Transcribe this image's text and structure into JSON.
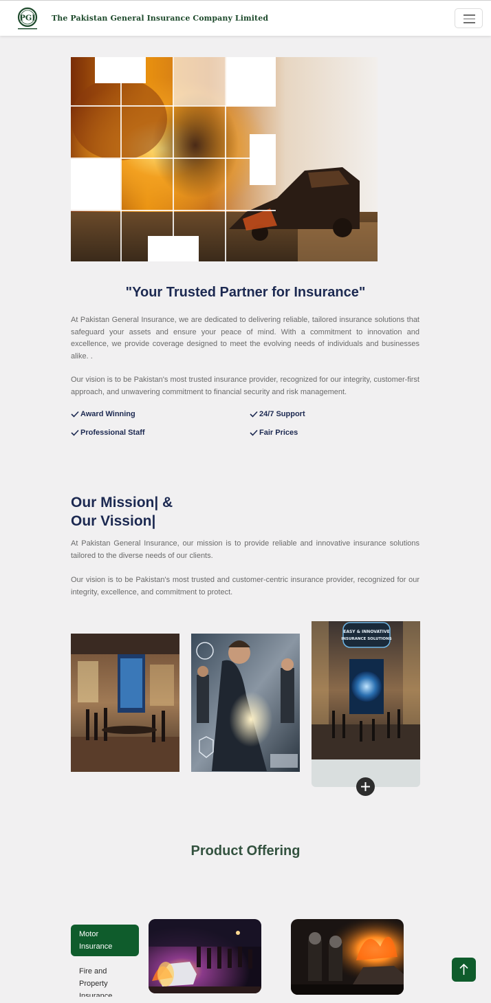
{
  "header": {
    "logo_text": "PGI",
    "company_name": "The Pakistan General Insurance Company Limited",
    "menu_icon": "hamburger-icon"
  },
  "about": {
    "heading": "\"Your Trusted Partner for Insurance\"",
    "paragraph_1": "At Pakistan General Insurance, we are dedicated to delivering reliable, tailored insurance solutions that safeguard your assets and ensure your peace of mind. With a commitment to innovation and excellence, we provide coverage designed to meet the evolving needs of individuals and businesses alike. .",
    "paragraph_2": "Our vision is to be Pakistan's most trusted insurance provider, recognized for our integrity, customer-first approach, and unwavering commitment to financial security and risk management.",
    "features": [
      "Award Winning",
      "24/7 Support",
      "Professional Staff",
      "Fair Prices"
    ]
  },
  "mission": {
    "heading_line_1": "Our Mission| &",
    "heading_line_2": "Our Vission|",
    "paragraph_1": "At Pakistan General Insurance, our mission is to provide reliable and innovative insurance solutions tailored to the diverse needs of our clients.",
    "paragraph_2": "Our vision is to be Pakistan's most trusted and customer-centric insurance provider, recognized for our integrity, excellence, and commitment to protect.",
    "banner_text": "EASY & INNOVATIVE INSURANCE SOLUTIONS"
  },
  "products": {
    "heading": "Product Offering",
    "tabs": [
      {
        "label": "Motor Insurance",
        "active": true
      },
      {
        "label": "Fire and Property Insurance",
        "active": false
      }
    ]
  },
  "colors": {
    "brand_green": "#0f5c2c",
    "navy": "#1c2951",
    "heading_green": "#33523f",
    "page_bg": "#f1f0f1"
  }
}
